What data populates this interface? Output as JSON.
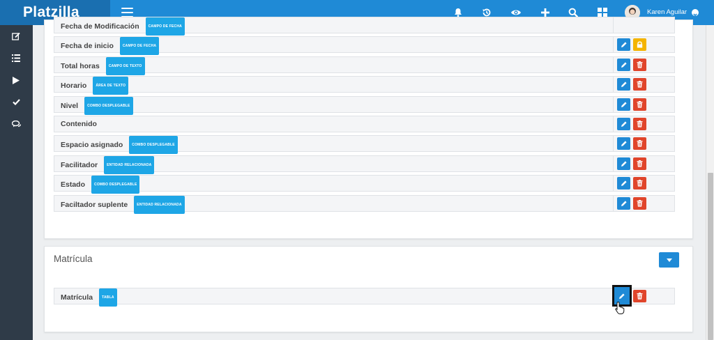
{
  "app": {
    "brand": "Platzilla"
  },
  "header": {
    "icons": [
      "bell-icon",
      "history-icon",
      "eye-icon",
      "plus-icon",
      "search-icon",
      "apps-grid-icon"
    ],
    "user": {
      "name": "Karen Aguilar"
    }
  },
  "sidebar": {
    "items": [
      "edit-icon",
      "list-icon",
      "play-icon",
      "check-icon",
      "chat-icon"
    ]
  },
  "fields_section": {
    "rows": [
      {
        "label": "Fecha de Modificación",
        "badge": "CAMPO DE FECHA",
        "action": "none"
      },
      {
        "label": "Fecha de inicio",
        "badge": "CAMPO DE FECHA",
        "action": "lock"
      },
      {
        "label": "Total horas",
        "badge": "CAMPO DE TEXTO",
        "action": "delete"
      },
      {
        "label": "Horario",
        "badge": "ÁREA DE TEXTO",
        "action": "delete"
      },
      {
        "label": "Nivel",
        "badge": "COMBO DESPLEGABLE",
        "action": "delete"
      },
      {
        "label": "Contenido",
        "badge": "",
        "action": "delete"
      },
      {
        "label": "Espacio asignado",
        "badge": "COMBO DESPLEGABLE",
        "action": "delete"
      },
      {
        "label": "Facilitador",
        "badge": "ENTIDAD RELACIONADA",
        "action": "delete"
      },
      {
        "label": "Estado",
        "badge": "COMBO DESPLEGABLE",
        "action": "delete"
      },
      {
        "label": "Faciltador suplente",
        "badge": "ENTIDAD RELACIONADA",
        "action": "delete"
      }
    ]
  },
  "matricula_section": {
    "title": "Matrícula",
    "rows": [
      {
        "label": "Matrícula",
        "badge": "TABLA"
      }
    ]
  },
  "colors": {
    "primary": "#1f8ad6",
    "brand_bg": "#1a6fb0",
    "danger": "#e0452b",
    "warning": "#f4b400",
    "badge": "#1ea6e6",
    "sidebar": "#2f3b48"
  }
}
